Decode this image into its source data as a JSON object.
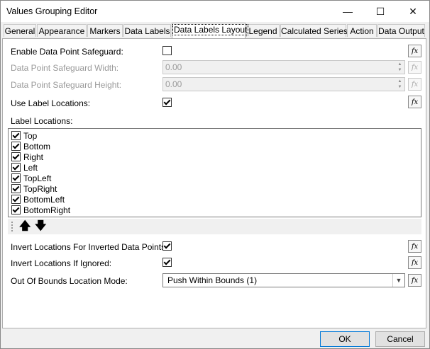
{
  "window": {
    "title": "Values Grouping Editor",
    "minimize": "—",
    "maximize": "☐",
    "close": "✕"
  },
  "tabs": [
    "General",
    "Appearance",
    "Markers",
    "Data Labels",
    "Data Labels Layout",
    "Legend",
    "Calculated Series",
    "Action",
    "Data Output"
  ],
  "active_tab": "Data Labels Layout",
  "form": {
    "enable_safeguard": {
      "label": "Enable Data Point Safeguard:",
      "checked": false
    },
    "safeguard_width": {
      "label": "Data Point Safeguard Width:",
      "value": "0.00",
      "enabled": false
    },
    "safeguard_height": {
      "label": "Data Point Safeguard Height:",
      "value": "0.00",
      "enabled": false
    },
    "use_label_locations": {
      "label": "Use Label Locations:",
      "checked": true
    },
    "label_locations": {
      "label": "Label Locations:",
      "items": [
        {
          "label": "Top",
          "checked": true
        },
        {
          "label": "Bottom",
          "checked": true
        },
        {
          "label": "Right",
          "checked": true
        },
        {
          "label": "Left",
          "checked": true
        },
        {
          "label": "TopLeft",
          "checked": true
        },
        {
          "label": "TopRight",
          "checked": true
        },
        {
          "label": "BottomLeft",
          "checked": true
        },
        {
          "label": "BottomRight",
          "checked": true
        }
      ]
    },
    "move_up": "🡅",
    "move_down": "🡇",
    "invert_inverted": {
      "label": "Invert Locations For Inverted Data Points:",
      "checked": true
    },
    "invert_ignored": {
      "label": "Invert Locations If Ignored:",
      "checked": true
    },
    "out_of_bounds": {
      "label": "Out Of Bounds Location Mode:",
      "value": "Push Within Bounds (1)"
    },
    "fx_label": "fx"
  },
  "footer": {
    "ok": "OK",
    "cancel": "Cancel"
  }
}
